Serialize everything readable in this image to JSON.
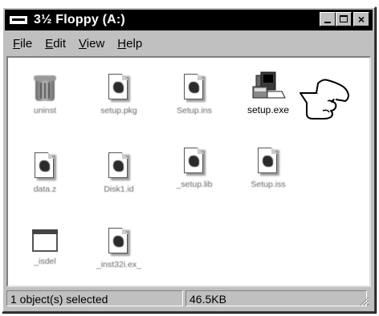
{
  "window": {
    "title": "3½ Floppy (A:)",
    "title_icon": "floppy-drive-icon",
    "buttons": {
      "minimize": "minimize",
      "maximize": "maximize",
      "close": "×"
    }
  },
  "menu": [
    {
      "underline": "F",
      "rest": "ile"
    },
    {
      "underline": "E",
      "rest": "dit"
    },
    {
      "underline": "V",
      "rest": "iew"
    },
    {
      "underline": "H",
      "rest": "elp"
    }
  ],
  "files": [
    {
      "name": "uninst",
      "icon": "recycle-bin-icon"
    },
    {
      "name": "setup.pkg",
      "icon": "document-icon"
    },
    {
      "name": "Setup.ins",
      "icon": "document-icon"
    },
    {
      "name": "setup.exe",
      "icon": "installer-icon",
      "selected": true
    },
    {
      "name": "data.z",
      "icon": "document-icon"
    },
    {
      "name": "Disk1.id",
      "icon": "document-icon"
    },
    {
      "name": "_setup.lib",
      "icon": "document-icon"
    },
    {
      "name": "Setup.iss",
      "icon": "document-icon"
    },
    {
      "name": "_isdel",
      "icon": "window-app-icon"
    },
    {
      "name": "_inst32i.ex_",
      "icon": "document-icon"
    }
  ],
  "status": {
    "selection": "1 object(s) selected",
    "size": "46.5KB"
  },
  "colors": {
    "titlebar": "#000000",
    "face": "#c0c0c0",
    "canvas": "#ffffff"
  }
}
